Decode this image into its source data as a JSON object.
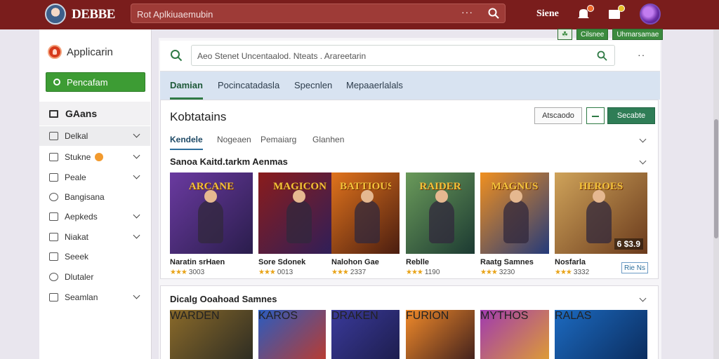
{
  "app": {
    "brand": "DEBBE",
    "title": "Applicarin"
  },
  "topbar": {
    "search_placeholder": "Rot Aplkiuaemubin",
    "search_more": "···",
    "signin": "Siene"
  },
  "sidebar": {
    "primary_button": "Pencafam",
    "section": "GAans",
    "items": [
      {
        "label": "Delkal",
        "icon": "monitor-icon"
      },
      {
        "label": "Stukne",
        "icon": "box-icon",
        "has_badge": true
      },
      {
        "label": "Peale",
        "icon": "tag-icon"
      },
      {
        "label": "Bangisana",
        "icon": "globe-icon"
      },
      {
        "label": "Aepkeds",
        "icon": "grid-icon"
      },
      {
        "label": "Niakat",
        "icon": "grid-icon"
      },
      {
        "label": "Seeek",
        "icon": "list-icon"
      },
      {
        "label": "Dlutaler",
        "icon": "clock-icon"
      },
      {
        "label": "Seamlan",
        "icon": "table-icon"
      }
    ]
  },
  "mini_tags": [
    "☘",
    "Cilsnee",
    "Uhmarsamae"
  ],
  "search": {
    "placeholder": "Aeo Stenet Uncentaalod. Nteats . Arareetarin",
    "more": "··"
  },
  "tabs": [
    "Damian",
    "Pocincatadasla",
    "Specnlen",
    "Mepaaerlalals"
  ],
  "card": {
    "title": "Kobtatains",
    "btn_outline": "Atscaodo",
    "btn_green": "Secabte",
    "subtabs": [
      "Kendele",
      "Nogeaen",
      "Pemaiarg",
      "Glanhen"
    ],
    "section1": "Sanoa Kaitd.tarkm Aenmas",
    "section2": "Dicalg Ooahoad Samnes",
    "games": [
      {
        "name": "Naratin srHaen",
        "rating": "3003",
        "tile": "ARCANE",
        "bg1": "#6a3aa0",
        "bg2": "#2a1d4c"
      },
      {
        "name": "Sore Sdonek",
        "rating": "0013",
        "tile": "MAGICON",
        "bg1": "#8a1c1c",
        "bg2": "#2a1f5c"
      },
      {
        "name": "Nalohon Gae",
        "rating": "2337",
        "tile": "BATTIOUS",
        "bg1": "#e0731c",
        "bg2": "#4a1d10"
      },
      {
        "name": "Reblle",
        "rating": "1190",
        "tile": "RAIDER",
        "bg1": "#6a9a5a",
        "bg2": "#1c3a32"
      },
      {
        "name": "Raatg Samnes",
        "rating": "3230",
        "tile": "MAGNUS",
        "bg1": "#f09020",
        "bg2": "#243a7a"
      },
      {
        "name": "Nosfarla",
        "rating": "3332",
        "tile": "HEROES",
        "bg1": "#cfa35a",
        "bg2": "#6a3a1c",
        "price": "6 $3.9"
      }
    ],
    "mini_button": "Rie Ns",
    "games2": [
      {
        "tile": "WARDEN",
        "bg1": "#8a6a2a",
        "bg2": "#2a2a22"
      },
      {
        "tile": "KAROS",
        "bg1": "#2a5cc0",
        "bg2": "#c03a2a"
      },
      {
        "tile": "DRAKEN",
        "bg1": "#3a3a9a",
        "bg2": "#1c1c4a"
      },
      {
        "tile": "FURION",
        "bg1": "#f08a2a",
        "bg2": "#3a1c1c"
      },
      {
        "tile": "MYTHOS",
        "bg1": "#a03ab0",
        "bg2": "#e0a030"
      },
      {
        "tile": "RALAS",
        "bg1": "#1c6ac0",
        "bg2": "#0a2a5a"
      }
    ]
  },
  "colors": {
    "topbar": "#7a1d1c",
    "accent_green": "#3d9c34",
    "tabs_bg": "#d8e3f1"
  }
}
